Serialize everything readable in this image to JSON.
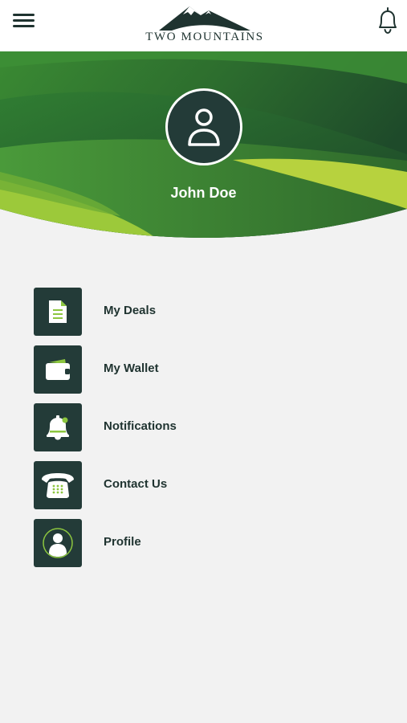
{
  "header": {
    "menu_icon": "hamburger-icon",
    "logo_text": "TWO MOUNTAINS",
    "notifications_icon": "bell-icon"
  },
  "profile": {
    "avatar_icon": "user-icon",
    "name": "John Doe"
  },
  "menu": {
    "items": [
      {
        "label": "My Deals",
        "icon": "document-icon"
      },
      {
        "label": "My Wallet",
        "icon": "wallet-icon"
      },
      {
        "label": "Notifications",
        "icon": "bell-icon"
      },
      {
        "label": "Contact Us",
        "icon": "telephone-icon"
      },
      {
        "label": "Profile",
        "icon": "user-circle-icon"
      }
    ]
  },
  "colors": {
    "dark_green": "#233b38",
    "accent_green": "#8cc63f",
    "background": "#f2f2f2"
  }
}
